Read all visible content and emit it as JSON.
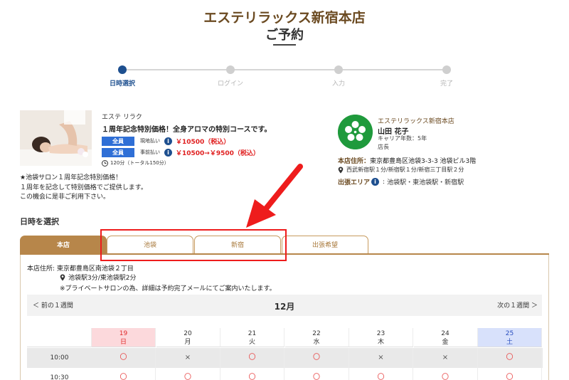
{
  "header": {
    "shop_name": "エステリラックス新宿本店",
    "page_title": "ご予約"
  },
  "steps": [
    {
      "label": "日時選択",
      "active": true
    },
    {
      "label": "ログイン",
      "active": false
    },
    {
      "label": "入力",
      "active": false
    },
    {
      "label": "完了",
      "active": false
    }
  ],
  "course": {
    "category": "エステ リラク",
    "title": "１周年記念特別価格！全身アロマの特別コースです。",
    "prices": [
      {
        "badge": "全員",
        "pay": "現地払い",
        "price": "￥10500（税込）"
      },
      {
        "badge": "全員",
        "pay": "事前払い",
        "price": "￥10500→￥9500（税込）"
      }
    ],
    "duration": "120分（トータル150分）",
    "description": [
      "★池袋サロン１周年記念特別価格！",
      "１周年を記念して特別価格でご提供します。",
      "この機会に是非ご利用下さい。"
    ]
  },
  "staff": {
    "shop": "エステリラックス新宿本店",
    "name": "山田 花子",
    "career": "キャリア年数：5年",
    "role": "店長",
    "address_label": "本店住所：",
    "address": "東京都豊島区池袋3-3-3 池袋ビル3階",
    "stations": "西武新宿駅１分/新宿駅１分/新宿三丁目駅２分",
    "area_label": "出張エリア",
    "area": "池袋駅・東池袋駅・新宿駅"
  },
  "booking": {
    "section_title": "日時を選択",
    "tabs": [
      {
        "label": "本店",
        "active": true
      },
      {
        "label": "池袋",
        "active": false
      },
      {
        "label": "新宿",
        "active": false
      },
      {
        "label": "出張希望",
        "active": false
      }
    ],
    "panel_address": "本店住所: 東京都豊島区南池袋２丁目",
    "panel_stations": "池袋駅3分/東池袋駅2分",
    "panel_note": "※プライベートサロンの為、詳細は予約完了メールにてご案内いたします。",
    "prev_week": "＜ 前の１週間",
    "month": "12月",
    "next_week": "次の１週間 ＞",
    "days": [
      {
        "date": "19",
        "weekday": "日",
        "kind": "sun"
      },
      {
        "date": "20",
        "weekday": "月",
        "kind": ""
      },
      {
        "date": "21",
        "weekday": "火",
        "kind": ""
      },
      {
        "date": "22",
        "weekday": "水",
        "kind": ""
      },
      {
        "date": "23",
        "weekday": "木",
        "kind": ""
      },
      {
        "date": "24",
        "weekday": "金",
        "kind": ""
      },
      {
        "date": "25",
        "weekday": "土",
        "kind": "sat"
      }
    ],
    "rows": [
      {
        "time": "10:00",
        "slots": [
          "〇",
          "×",
          "〇",
          "〇",
          "×",
          "×",
          "〇"
        ]
      },
      {
        "time": "10:30",
        "slots": [
          "〇",
          "〇",
          "〇",
          "〇",
          "〇",
          "〇",
          "〇"
        ]
      }
    ]
  },
  "colors": {
    "brand_brown": "#b7864a",
    "accent_blue": "#1d4f8f",
    "alert_red": "#e02020",
    "callout_red": "#ee1c1c"
  }
}
